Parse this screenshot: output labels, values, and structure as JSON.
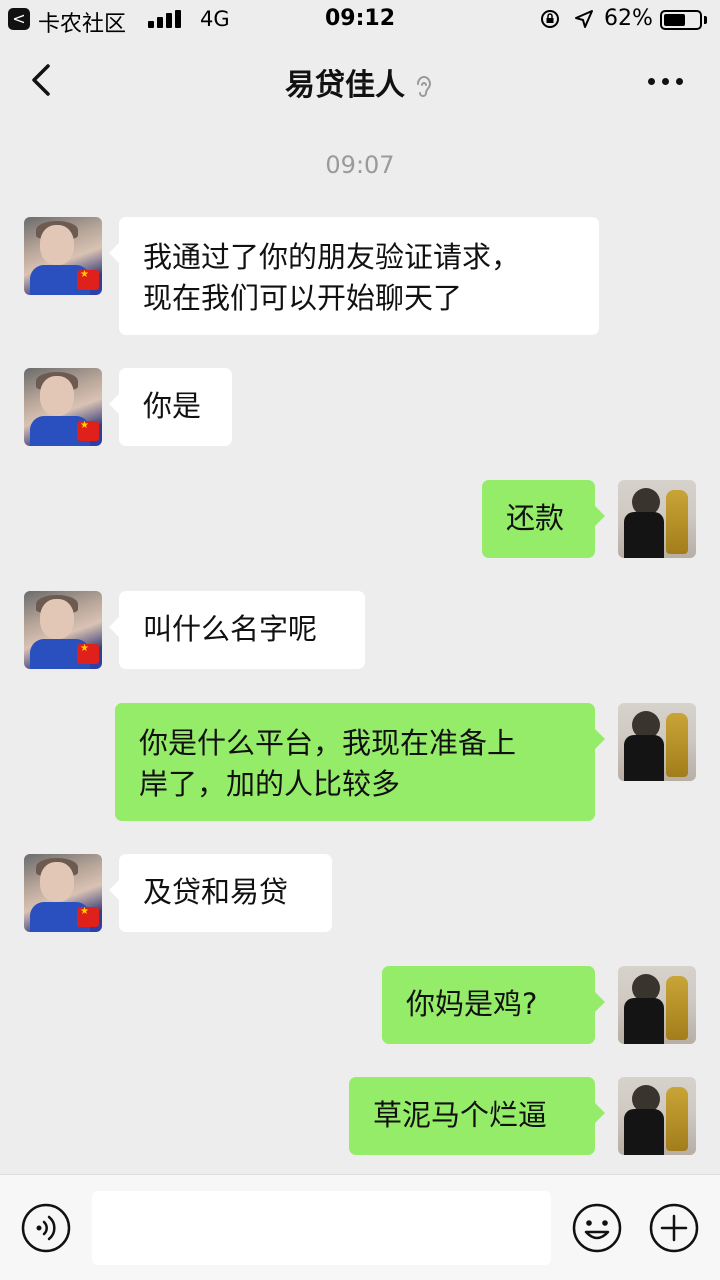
{
  "status_bar": {
    "back_glyph": "<",
    "carrier": "卡农社区",
    "network": "4G",
    "time": "09:12",
    "battery": "62%",
    "battery_level": 0.62
  },
  "header": {
    "title": "易贷佳人",
    "icons": [
      "back-icon",
      "earpiece-icon",
      "more-icon"
    ]
  },
  "timestamp": "09:07",
  "messages": [
    {
      "side": "left",
      "text_lines": [
        "我通过了你的朋友验证请求，",
        "现在我们可以开始聊天了"
      ]
    },
    {
      "side": "left",
      "text": "你是"
    },
    {
      "side": "right",
      "text": "还款"
    },
    {
      "side": "left",
      "text": "叫什么名字呢"
    },
    {
      "side": "right",
      "text_lines": [
        "你是什么平台，我现在准备上",
        "岸了，加的人比较多"
      ]
    },
    {
      "side": "left",
      "text": "及贷和易贷"
    },
    {
      "side": "right",
      "text": "你妈是鸡?"
    },
    {
      "side": "right",
      "text": "草泥马个烂逼"
    }
  ],
  "input_bar": {
    "field_value": "",
    "icons": [
      "voice-icon",
      "emoji-icon",
      "plus-icon"
    ]
  },
  "colors": {
    "background": "#ededed",
    "sent_bubble": "#95ec69",
    "received_bubble": "#ffffff"
  }
}
